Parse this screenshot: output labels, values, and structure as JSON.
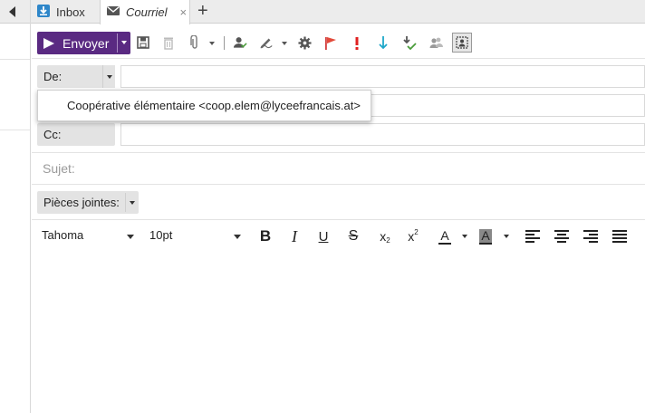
{
  "tabs": [
    {
      "label": "Inbox",
      "icon": "inbox-download-icon"
    },
    {
      "label": "Courriel",
      "icon": "envelope-icon",
      "close": "×"
    }
  ],
  "add_tab": "+",
  "toolbar": {
    "send_label": "Envoyer",
    "send_color": "#5a2a82",
    "icons": [
      "save-icon",
      "delete-icon",
      "attach-icon",
      "contacts-check-icon",
      "signature-icon",
      "settings-icon",
      "flag-icon",
      "priority-high-icon",
      "priority-low-icon",
      "receipt-icon",
      "address-book-icon",
      "vcard-icon"
    ]
  },
  "header": {
    "from_label": "De:",
    "cc_label": "Cc:",
    "subject_placeholder": "Sujet:",
    "attachments_label": "Pièces jointes:"
  },
  "from_dropdown": {
    "options": [
      "Coopérative élémentaire <coop.elem@lyceefrancais.at>"
    ]
  },
  "editor": {
    "font_family": "Tahoma",
    "font_size": "10pt",
    "subscript": "x",
    "subscript_mark": "2",
    "superscript": "x",
    "superscript_mark": "2",
    "bold": "B",
    "italic": "I",
    "underline": "U",
    "strike": "S",
    "text_color": "A",
    "highlight": "A"
  }
}
